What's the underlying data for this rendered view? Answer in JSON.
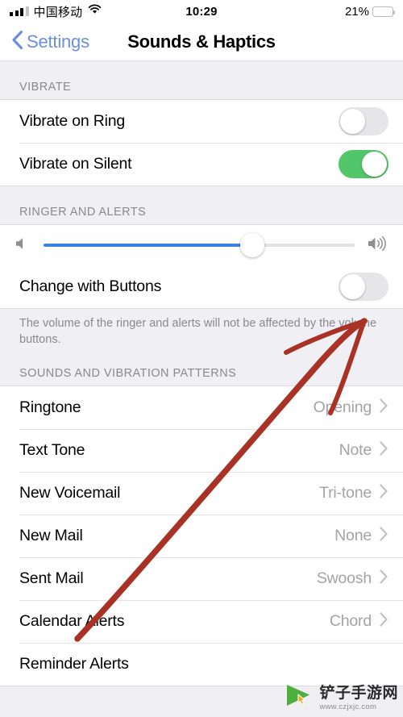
{
  "status_bar": {
    "carrier": "中国移动",
    "signal_icon": "cellular-signal-icon",
    "wifi_icon": "wifi-icon",
    "time": "10:29",
    "battery_percent": "21%",
    "battery_level": 21,
    "battery_color": "#FDCB2E",
    "battery_icon": "battery-icon"
  },
  "nav_bar": {
    "back_label": "Settings",
    "back_icon": "chevron-left-icon",
    "title": "Sounds & Haptics",
    "accent_color": "#6B8FE0"
  },
  "sections": {
    "vibrate": {
      "header": "VIBRATE",
      "rows": [
        {
          "label": "Vibrate on Ring",
          "toggle": "off"
        },
        {
          "label": "Vibrate on Silent",
          "toggle": "on"
        }
      ]
    },
    "ringer_and_alerts": {
      "header": "RINGER AND ALERTS",
      "slider": {
        "value": 67,
        "min_icon": "speaker-low-icon",
        "max_icon": "speaker-high-icon",
        "fill_color": "#3E7FE4"
      },
      "change_with_buttons": {
        "label": "Change with Buttons",
        "toggle": "off"
      },
      "footer": "The volume of the ringer and alerts will not be affected by the volume buttons."
    },
    "sounds_and_vibration_patterns": {
      "header": "SOUNDS AND VIBRATION PATTERNS",
      "rows": [
        {
          "label": "Ringtone",
          "value": "Opening"
        },
        {
          "label": "Text Tone",
          "value": "Note"
        },
        {
          "label": "New Voicemail",
          "value": "Tri-tone"
        },
        {
          "label": "New Mail",
          "value": "None"
        },
        {
          "label": "Sent Mail",
          "value": "Swoosh"
        },
        {
          "label": "Calendar Alerts",
          "value": "Chord"
        },
        {
          "label": "Reminder Alerts",
          "value": ""
        }
      ],
      "chevron_icon": "chevron-right-icon"
    }
  },
  "annotation": {
    "type": "hand-drawn-arrow",
    "color": "#A93226",
    "points_to": "Change with Buttons toggle"
  },
  "watermark": {
    "name": "铲子手游网",
    "url": "www.czjxjc.com",
    "logo_icon": "play-cursor-logo-icon",
    "logo_color": "#4CAF3E"
  },
  "toggle_colors": {
    "on": "#53C66A",
    "off": "#E6E6E9"
  }
}
